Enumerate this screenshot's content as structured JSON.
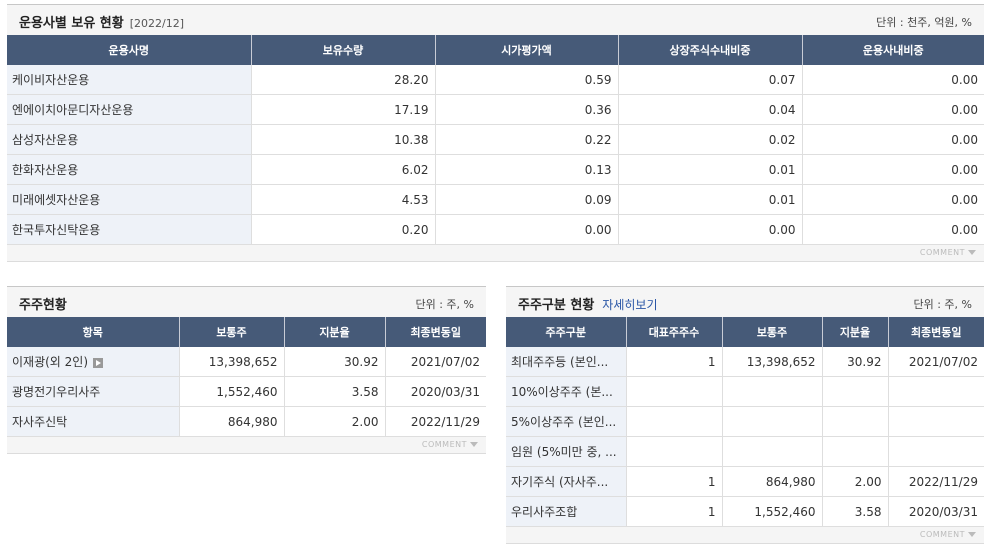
{
  "fund_section": {
    "title": "운용사별 보유 현황",
    "period": "[2022/12]",
    "unit": "단위 : 천주, 억원, %",
    "columns": [
      "운용사명",
      "보유수량",
      "시가평가액",
      "상장주식수내비중",
      "운용사내비중"
    ],
    "rows": [
      [
        "케이비자산운용",
        "28.20",
        "0.59",
        "0.07",
        "0.00"
      ],
      [
        "엔에이치아문디자산운용",
        "17.19",
        "0.36",
        "0.04",
        "0.00"
      ],
      [
        "삼성자산운용",
        "10.38",
        "0.22",
        "0.02",
        "0.00"
      ],
      [
        "한화자산운용",
        "6.02",
        "0.13",
        "0.01",
        "0.00"
      ],
      [
        "미래에셋자산운용",
        "4.53",
        "0.09",
        "0.01",
        "0.00"
      ],
      [
        "한국투자신탁운용",
        "0.20",
        "0.00",
        "0.00",
        "0.00"
      ]
    ],
    "comment": "COMMENT"
  },
  "shareholder_section": {
    "title": "주주현황",
    "unit": "단위 : 주, %",
    "columns": [
      "항목",
      "보통주",
      "지분율",
      "최종변동일"
    ],
    "rows": [
      [
        "이재광(외 2인)",
        "13,398,652",
        "30.92",
        "2021/07/02"
      ],
      [
        "광명전기우리사주",
        "1,552,460",
        "3.58",
        "2020/03/31"
      ],
      [
        "자사주신탁",
        "864,980",
        "2.00",
        "2022/11/29"
      ]
    ],
    "more_icon": "play-arrow-icon",
    "comment": "COMMENT"
  },
  "category_section": {
    "title": "주주구분 현황",
    "link": "자세히보기",
    "unit": "단위 : 주, %",
    "columns": [
      "주주구분",
      "대표주주수",
      "보통주",
      "지분율",
      "최종변동일"
    ],
    "rows": [
      [
        "최대주주등 (본인...",
        "1",
        "13,398,652",
        "30.92",
        "2021/07/02"
      ],
      [
        "10%이상주주 (본...",
        "",
        "",
        "",
        ""
      ],
      [
        "5%이상주주 (본인...",
        "",
        "",
        "",
        ""
      ],
      [
        "임원 (5%미만 중, ...",
        "",
        "",
        "",
        ""
      ],
      [
        "자기주식 (자사주...",
        "1",
        "864,980",
        "2.00",
        "2022/11/29"
      ],
      [
        "우리사주조합",
        "1",
        "1,552,460",
        "3.58",
        "2020/03/31"
      ]
    ],
    "comment": "COMMENT"
  }
}
